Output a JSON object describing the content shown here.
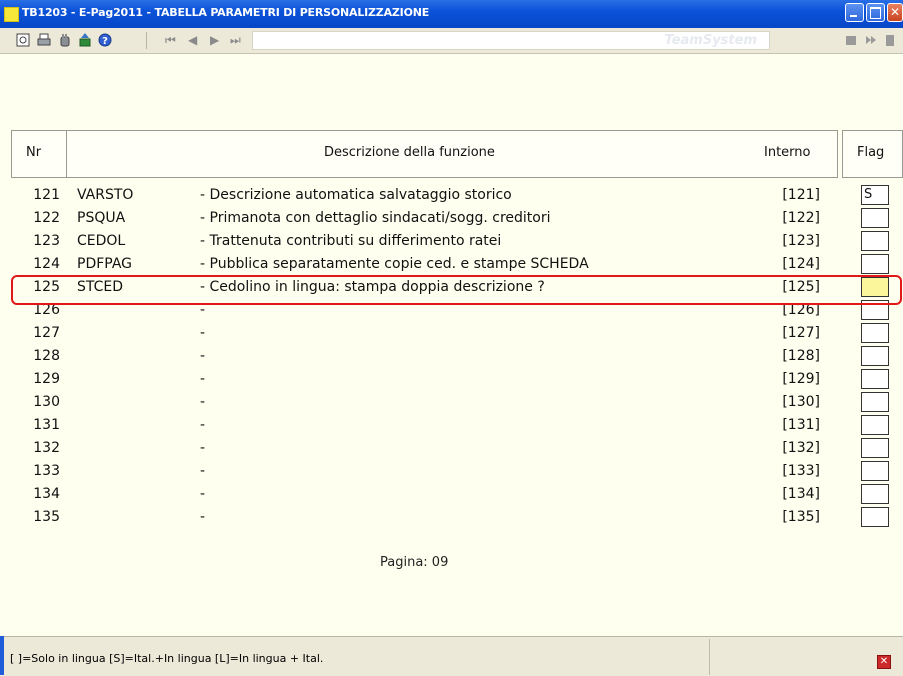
{
  "window": {
    "title": "TB1203  - E-Pag2011  -  TABELLA PARAMETRI DI PERSONALIZZAZIONE"
  },
  "toolbar": {
    "brand": "TeamSystem",
    "nav": {
      "first": "⏮",
      "prev": "◀",
      "next": "▶",
      "last": "⏭"
    }
  },
  "table": {
    "headers": {
      "nr": "Nr",
      "description": "Descrizione della funzione",
      "internal": "Interno",
      "flag": "Flag"
    },
    "rows": [
      {
        "nr": "121",
        "code": "VARSTO",
        "desc": "- Descrizione automatica salvataggio storico",
        "internal": "[121]",
        "flag": "S"
      },
      {
        "nr": "122",
        "code": "PSQUA",
        "desc": "- Primanota con dettaglio sindacati/sogg. creditori",
        "internal": "[122]",
        "flag": ""
      },
      {
        "nr": "123",
        "code": "CEDOL",
        "desc": "- Trattenuta contributi su differimento ratei",
        "internal": "[123]",
        "flag": ""
      },
      {
        "nr": "124",
        "code": "PDFPAG",
        "desc": "- Pubblica separatamente copie ced. e stampe SCHEDA",
        "internal": "[124]",
        "flag": ""
      },
      {
        "nr": "125",
        "code": "STCED",
        "desc": "- Cedolino in lingua: stampa doppia descrizione ?",
        "internal": "[125]",
        "flag": ""
      },
      {
        "nr": "126",
        "code": "",
        "desc": "-",
        "internal": "[126]",
        "flag": ""
      },
      {
        "nr": "127",
        "code": "",
        "desc": "-",
        "internal": "[127]",
        "flag": ""
      },
      {
        "nr": "128",
        "code": "",
        "desc": "-",
        "internal": "[128]",
        "flag": ""
      },
      {
        "nr": "129",
        "code": "",
        "desc": "-",
        "internal": "[129]",
        "flag": ""
      },
      {
        "nr": "130",
        "code": "",
        "desc": "-",
        "internal": "[130]",
        "flag": ""
      },
      {
        "nr": "131",
        "code": "",
        "desc": "-",
        "internal": "[131]",
        "flag": ""
      },
      {
        "nr": "132",
        "code": "",
        "desc": "-",
        "internal": "[132]",
        "flag": ""
      },
      {
        "nr": "133",
        "code": "",
        "desc": "-",
        "internal": "[133]",
        "flag": ""
      },
      {
        "nr": "134",
        "code": "",
        "desc": "-",
        "internal": "[134]",
        "flag": ""
      },
      {
        "nr": "135",
        "code": "",
        "desc": "-",
        "internal": "[135]",
        "flag": ""
      }
    ],
    "active_row_index": 4
  },
  "pagination": {
    "label": "Pagina: 09"
  },
  "status": {
    "hint": "[ ]=Solo in lingua [S]=Ital.+In lingua [L]=In lingua + Ital."
  },
  "colors": {
    "highlight": "#e01818",
    "active_flag": "#fbf59c",
    "titlebar": "#0a52d8"
  }
}
